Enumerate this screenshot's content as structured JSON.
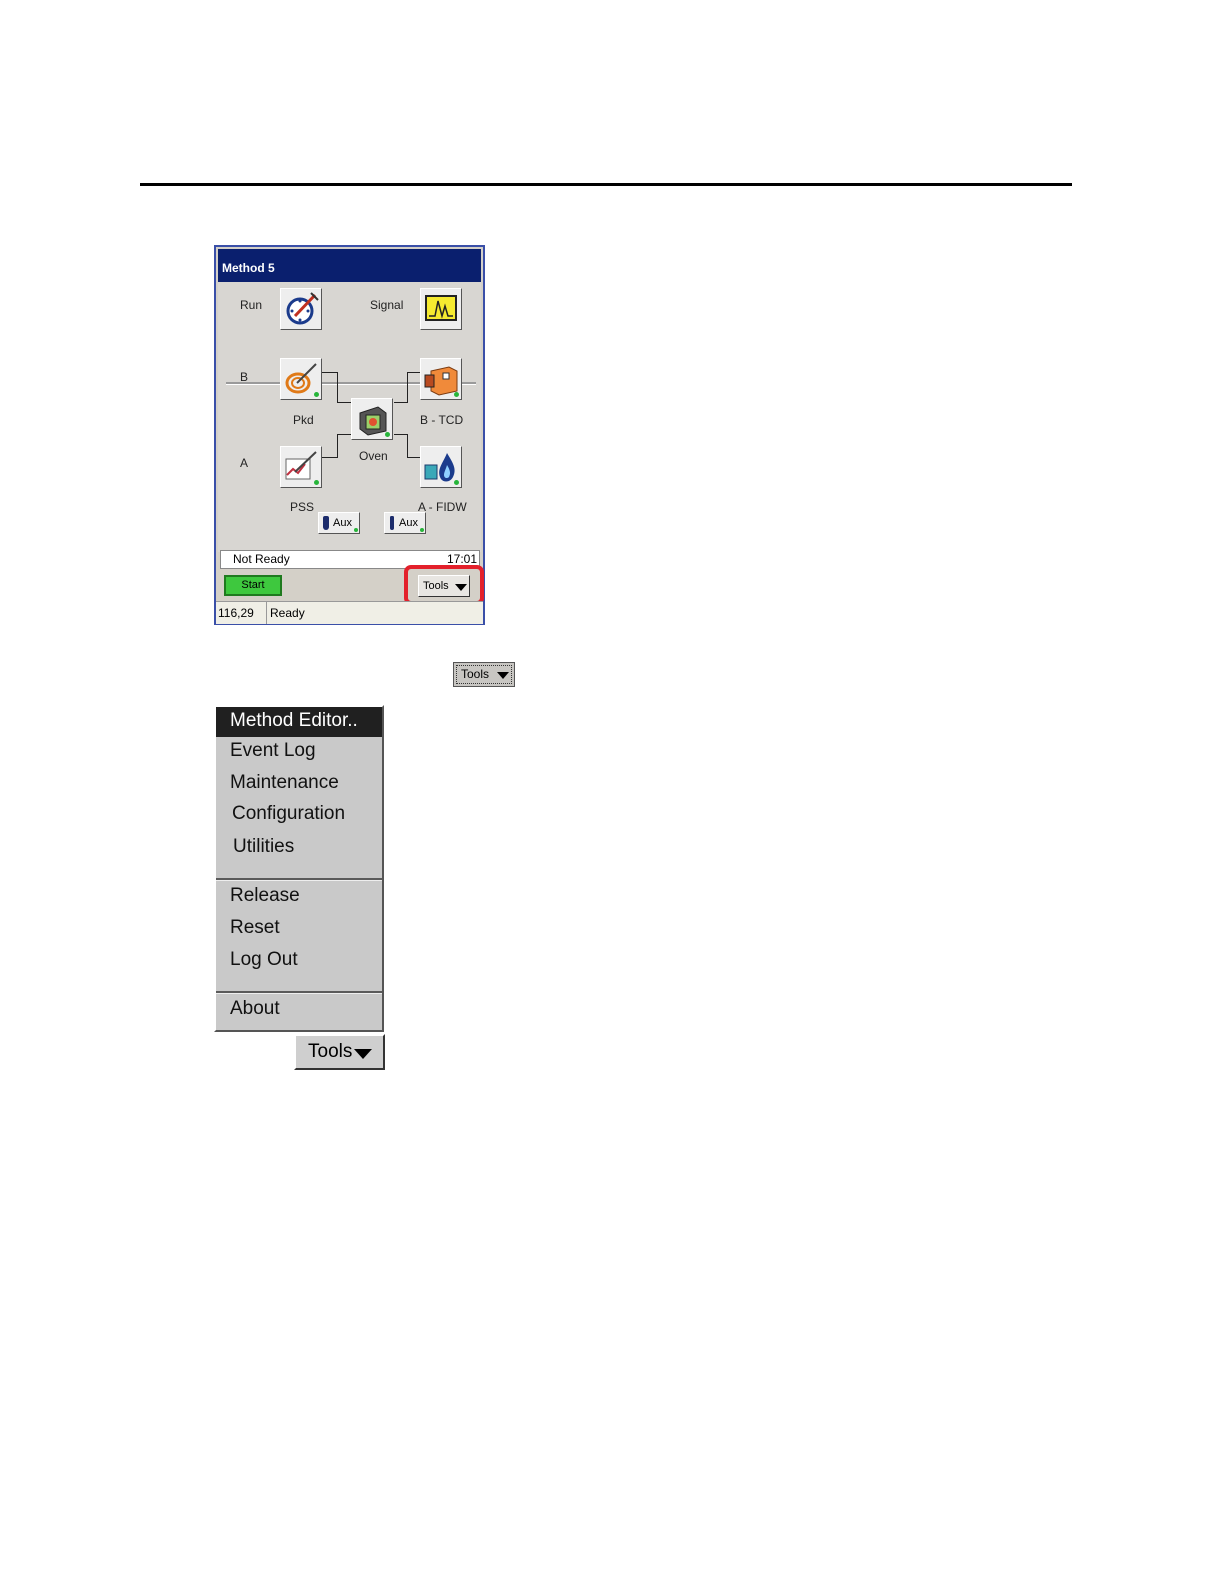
{
  "device": {
    "title": "Method 5",
    "run_label": "Run",
    "signal_label": "Signal",
    "row_b_label": "B",
    "row_a_label": "A",
    "inlet_b_label": "Pkd",
    "inlet_a_label": "PSS",
    "oven_label": "Oven",
    "detector_b_label": "B - TCD",
    "detector_a_label": "A - FIDW",
    "aux1_label": "Aux",
    "aux2_label": "Aux",
    "status_text": "Not Ready",
    "clock": "17:01",
    "start_label": "Start",
    "tools_label": "Tools",
    "coords": "116,29",
    "bottom_status": "Ready"
  },
  "tools_button_label": "Tools",
  "menu": {
    "group1": [
      "Method Editor..",
      "Event Log",
      "Maintenance",
      "Configuration",
      "Utilities"
    ],
    "group2": [
      "Release",
      "Reset",
      "Log Out"
    ],
    "group3": [
      "About"
    ],
    "selected": "Method Editor.."
  },
  "tools_big_label": "Tools",
  "colors": {
    "title_bar": "#0a1f6e",
    "highlight": "#e3202b",
    "start_green": "#3ec83e",
    "status_dot": "#27b53a"
  },
  "icons": {
    "run": "stopwatch-syringe-icon",
    "signal": "chromatogram-icon",
    "inlet_b": "packed-column-icon",
    "inlet_a": "split-splitless-icon",
    "oven": "oven-icon",
    "detector_b": "tcd-detector-icon",
    "detector_a": "fid-flame-icon"
  }
}
